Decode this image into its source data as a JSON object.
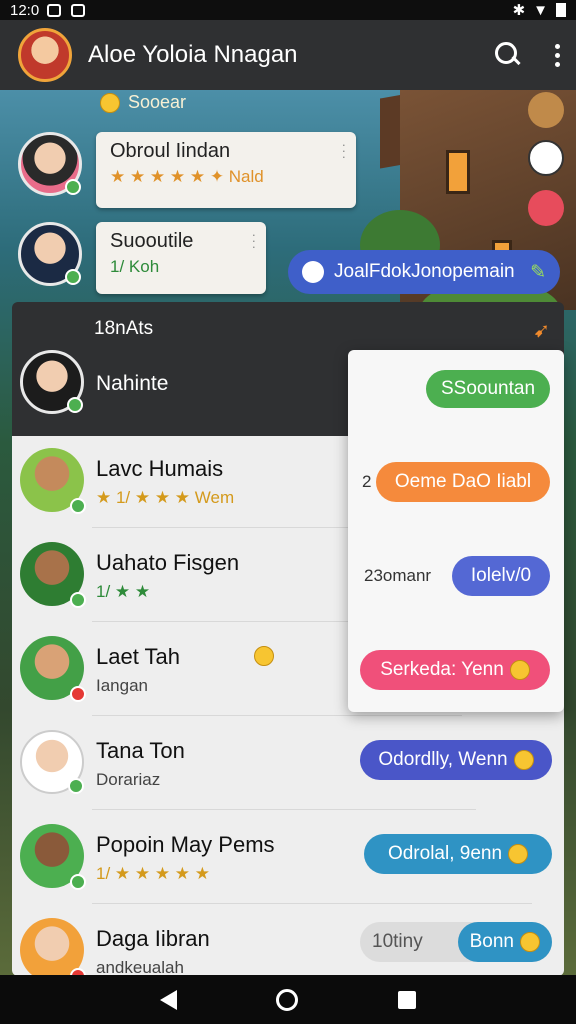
{
  "status_bar": {
    "time": "12:0"
  },
  "app_bar": {
    "title": "Aloe Yoloia Nnagan",
    "search_icon": "search-icon",
    "menu_icon": "more-vert-icon"
  },
  "section": {
    "label": "Sooear"
  },
  "chats": [
    {
      "name": "Obroul Iindan",
      "sub": "★ ★ ★ ★ ★ ✦ Nald"
    },
    {
      "name": "Suooutile",
      "sub": "1/ Koh"
    }
  ],
  "blue_pill": {
    "label": "JoalFdokJonopemain"
  },
  "dark_panel": {
    "header": "18nAts",
    "name": "Nahinte"
  },
  "list": [
    {
      "name": "Lavc Humais",
      "sub": "★ 1/ ★ ★ ★ Wem"
    },
    {
      "name": "Uahato Fisgen",
      "sub": "1/ ★ ★"
    },
    {
      "name": "Laet Tah",
      "sub": "Iangan"
    },
    {
      "name": "Tana Ton",
      "sub": "Dorariaz"
    },
    {
      "name": "Popoin May Pems",
      "sub": "1/ ★ ★ ★ ★ ★"
    },
    {
      "name": "Daga Iibran",
      "sub": "andkeualah"
    }
  ],
  "popup": {
    "button_top": "SSoountan",
    "rows": [
      {
        "prefix": "2",
        "chip": "Oeme DaO Iiabl"
      },
      {
        "prefix": "23omanr",
        "chip": "Iolelv/0"
      },
      {
        "prefix": "",
        "chip": "Serkeda: Yenn"
      }
    ]
  },
  "list_chips": [
    {
      "label": "Odordlly, Wenn"
    },
    {
      "label": "Odrolal, 9enn"
    },
    {
      "prefix": "10tiny",
      "label": "Bonn"
    }
  ],
  "colors": {
    "green": "#4caf50",
    "orange": "#f58a3c",
    "blue": "#5468d4",
    "pink": "#f0507a",
    "purple": "#4a56c8",
    "teal": "#2f93c4"
  }
}
